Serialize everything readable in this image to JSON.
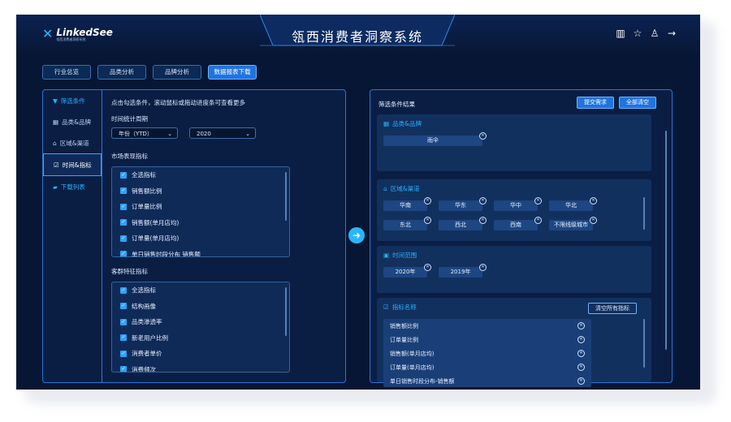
{
  "header": {
    "logo_text": "LinkedSee",
    "logo_sub": "瓴西消费者洞察系统",
    "title": "瓴西消费者洞察系统",
    "icons": [
      "book-icon",
      "star-icon",
      "user-icon",
      "logout-arrow-icon"
    ]
  },
  "tabs": [
    {
      "label": "行业总览",
      "active": false
    },
    {
      "label": "品类分析",
      "active": false
    },
    {
      "label": "品牌分析",
      "active": false
    },
    {
      "label": "数据报表下载",
      "active": true
    }
  ],
  "sidebar": {
    "items": [
      {
        "label": "筛选条件",
        "icon": "filter-icon"
      },
      {
        "label": "品类&品牌",
        "icon": "grid-icon"
      },
      {
        "label": "区域&渠道",
        "icon": "pin-icon"
      },
      {
        "label": "时间&指标",
        "icon": "checkbox-icon"
      },
      {
        "label": "下载列表",
        "icon": "folder-icon"
      }
    ]
  },
  "left": {
    "hint": "点击勾选条件，滚动鼠标或拖动进度条可查看更多",
    "period_label": "时间统计周期",
    "period_select": "年份（YTD）",
    "year_select": "2020",
    "market_label": "市场表现指标",
    "market_items": [
      "全选指标",
      "销售额比例",
      "订单量比例",
      "销售额(单月店均)",
      "订单量(单月店均)",
      "单日销售时段分布 销售额"
    ],
    "crowd_label": "客群特征指标",
    "crowd_items": [
      "全选指标",
      "结构画像",
      "品类渗透率",
      "新老用户比例",
      "消费者单价",
      "消费频次"
    ]
  },
  "right": {
    "title": "筛选条件结果",
    "submit_label": "提交需求",
    "clear_label": "全部清空",
    "cat_title": "品类&品牌",
    "cat_chips": [
      "雨伞"
    ],
    "region_title": "区域&渠道",
    "region_chips": [
      "华南",
      "华东",
      "华中",
      "华北",
      "东北",
      "西北",
      "西南",
      "不限线级城市"
    ],
    "time_title": "时间范围",
    "time_chips": [
      "2020年",
      "2019年"
    ],
    "ind_title": "指标名称",
    "ind_clear_label": "清空所有指标",
    "ind_items": [
      "销售额比例",
      "订单量比例",
      "销售额(单月店均)",
      "订单量(单月店均)",
      "单日销售时段分布-销售额"
    ]
  }
}
